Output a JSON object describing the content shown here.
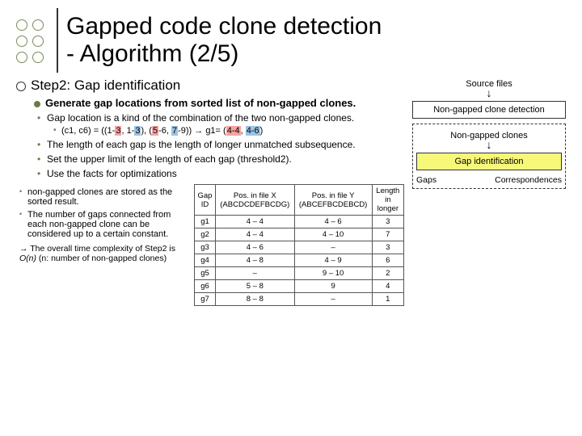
{
  "title_line1": "Gapped code clone detection",
  "title_line2": "- Algorithm (2/5)",
  "step_title": "Step2: Gap identification",
  "gen_line": "Generate gap locations from sorted list of non-gapped clones.",
  "sub_gap_loc": "Gap location is a kind of the combination of the two non-gapped clones.",
  "example_prefix": "(c1, c6) = ((1-",
  "ex_a": "3",
  "ex_mid1": ", 1-",
  "ex_b": "3",
  "ex_mid2": "), (",
  "ex_c": "5",
  "ex_mid3": "-6, ",
  "ex_d": "7",
  "ex_mid4": "-9)) → g1= (",
  "ex_e": "4-4",
  "ex_mid5": ", ",
  "ex_f": "4-6",
  "ex_end": ")",
  "sub_length": "The length of each gap is the length of longer unmatched subsequence.",
  "sub_threshold": "Set the upper limit of the length of each gap (threshold2).",
  "sub_opt": "Use the facts for optimizations",
  "opt1": "non-gapped clones are stored as the sorted result.",
  "opt2": "The number of gaps connected from each non-gapped clone can be considered up to a certain constant.",
  "complexity_arrow": "→ The overall time complexity of Step2 is ",
  "complexity_big_o": "O(n)",
  "complexity_paren": " (n: number of non-gapped clones)",
  "flow": {
    "source": "Source files",
    "nongapped_box": "Non-gapped clone detection",
    "nongapped_label": "Non-gapped clones",
    "gap_box": "Gap identification",
    "gaps_label": "Gaps",
    "corr_label": "Correspondences"
  },
  "chart_data": {
    "type": "table",
    "title": "Gap table",
    "columns": [
      "Gap ID",
      "Pos. in file X (ABCDCDEFBCDG)",
      "Pos. in file Y (ABCEFBCDEBCD)",
      "Length in longer"
    ],
    "rows": [
      [
        "g1",
        "4 – 4",
        "4 – 6",
        "3"
      ],
      [
        "g2",
        "4 – 4",
        "4 – 10",
        "7"
      ],
      [
        "g3",
        "4 – 6",
        "–",
        "3"
      ],
      [
        "g4",
        "4 – 8",
        "4 – 9",
        "6"
      ],
      [
        "g5",
        "–",
        "9 – 10",
        "2"
      ],
      [
        "g6",
        "5 – 8",
        "9",
        "4"
      ],
      [
        "g7",
        "8 – 8",
        "–",
        "1"
      ]
    ]
  }
}
